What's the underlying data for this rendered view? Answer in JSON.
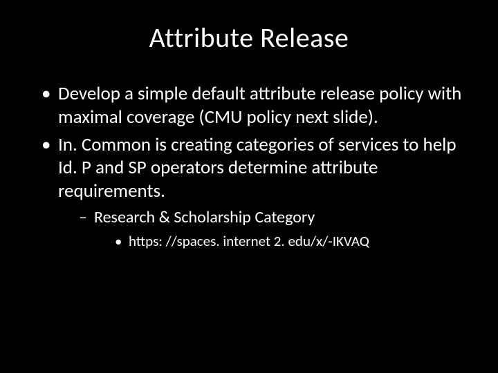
{
  "title": "Attribute Release",
  "bullets": [
    {
      "text": "Develop a simple default attribute release policy with maximal coverage (CMU policy next slide)."
    },
    {
      "text": "In. Common is creating categories of services to help Id. P and SP operators determine attribute requirements.",
      "children": [
        {
          "text": "Research & Scholarship Category",
          "children": [
            {
              "text": "https: //spaces. internet 2. edu/x/-IKVAQ"
            }
          ]
        }
      ]
    }
  ]
}
